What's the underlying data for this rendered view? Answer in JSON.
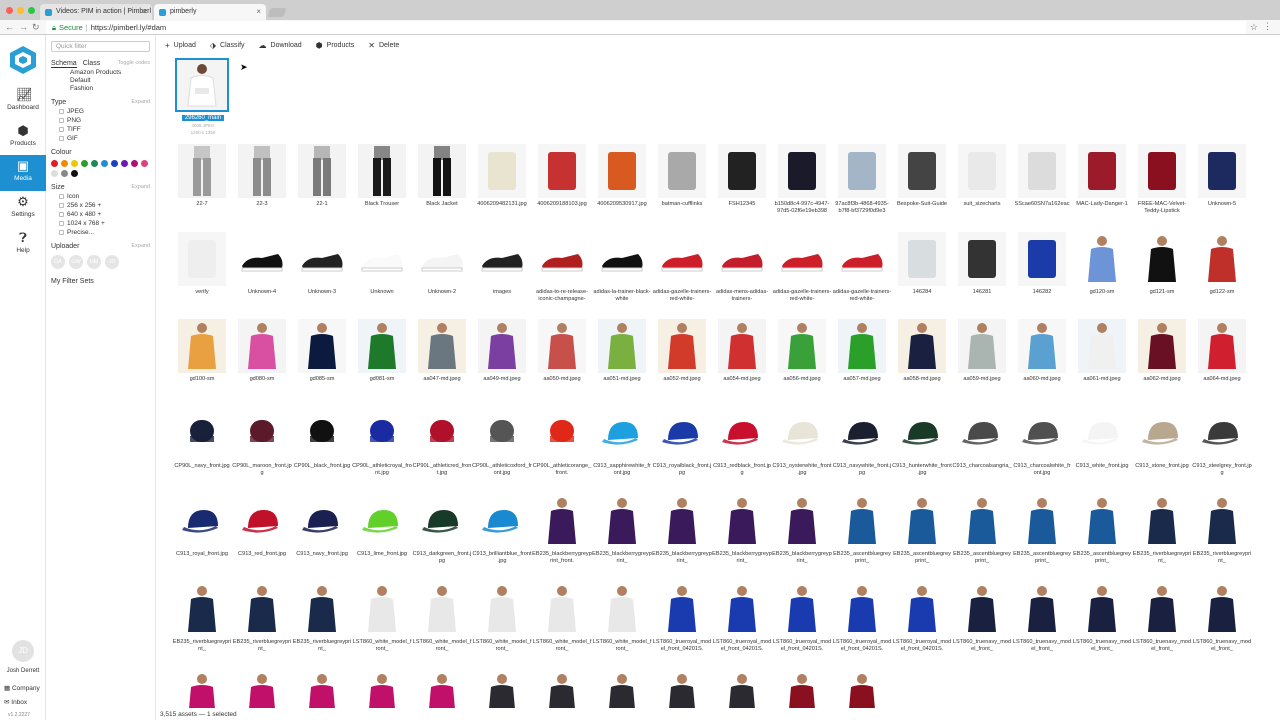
{
  "browser": {
    "tabs": [
      {
        "title": "Videos: PIM in action | Pimberl"
      },
      {
        "title": "pimberly"
      }
    ],
    "security_label": "Secure",
    "url": "https://pimberl.ly/#dam"
  },
  "rail": {
    "items": [
      {
        "label": "Dashboard",
        "icon": "chart-icon"
      },
      {
        "label": "Products",
        "icon": "cube-icon"
      },
      {
        "label": "Media",
        "icon": "image-icon",
        "active": true
      },
      {
        "label": "Settings",
        "icon": "gear-icon"
      },
      {
        "label": "Help",
        "icon": "help-icon"
      }
    ],
    "avatar_initials": "JD",
    "user_name": "Josh Derrett",
    "company_label": "Company",
    "inbox_label": "Inbox",
    "version": "v1.2.2227"
  },
  "filters": {
    "quick_filter_placeholder": "Quick filter",
    "schema_label": "Schema",
    "class_label": "Class",
    "toggle_label": "Toggle codes",
    "schema_items": [
      "Amazon Products",
      "Default",
      "Fashion"
    ],
    "type_label": "Type",
    "expand_label": "Expand",
    "types": [
      "JPEG",
      "PNG",
      "TIFF",
      "GIF"
    ],
    "colour_label": "Colour",
    "colours": [
      "#e02020",
      "#f08a00",
      "#f0c800",
      "#2aa02a",
      "#1a8a5a",
      "#1e8fd0",
      "#1a3fc0",
      "#6a1ab0",
      "#b0107a",
      "#e04080",
      "#dddddd",
      "#888888",
      "#111111"
    ],
    "size_label": "Size",
    "sizes": [
      "Icon",
      "256 x 256 +",
      "640 x 480 +",
      "1024 x 768 +",
      "Precise..."
    ],
    "uploader_label": "Uploader",
    "uploaders": [
      "DA",
      "GW",
      "HM",
      "JD"
    ],
    "my_filters_label": "My Filter Sets"
  },
  "toolbar": {
    "upload": "Upload",
    "classify": "Classify",
    "download": "Download",
    "products": "Products",
    "delete": "Delete"
  },
  "featured": {
    "label": "296260_main",
    "meta1": "4005 JPEG",
    "meta2": "1200 x 1350"
  },
  "rows": [
    [
      "22-7",
      "22-3",
      "22-1",
      "Black Trouser",
      "Black Jacket",
      "4006209482131.jpg",
      "4006209188103.jpg",
      "4006209530917.jpg",
      "batman-cufflinks",
      "FSH12345",
      "b150d8c4-997c-4947-97d5-02f6e19eb398",
      "97ac8f3b-4868-4935-b7f8-bf3729f0d9e3",
      "Bespoke-Suit-Guide",
      "suit_sizecharts",
      "SScae60SN7a162eac",
      "MAC-Lady-Danger-1",
      "FREE-MAC-Velvet-Teddy-Lipstick",
      "Unknown-5"
    ],
    [
      "verify",
      "Unknown-4",
      "Unknown-3",
      "Unknown",
      "Unknown-2",
      "images",
      "adidas-to-re-release-iconic-champagne-",
      "adidas-la-trainer-black-white",
      "adidas-gazelle-trainers-red-white-",
      "adidas-mens-adidas-trainers-",
      "adidas-gazelle-trainers-red-white-",
      "adidas-gazelle-trainers-red-white-",
      "146284",
      "146281",
      "146282",
      "gd120-sm",
      "gd121-sm",
      "gd122-sm"
    ],
    [
      "gd100-sm",
      "gd080-sm",
      "gd085-sm",
      "gd081-sm",
      "aa047-md.jpeg",
      "aa049-md.jpeg",
      "aa050-md.jpeg",
      "aa051-md.jpeg",
      "aa052-md.jpeg",
      "aa054-md.jpeg",
      "aa056-md.jpeg",
      "aa057-md.jpeg",
      "aa058-md.jpeg",
      "aa059-md.jpeg",
      "aa060-md.jpeg",
      "aa061-md.jpeg",
      "aa062-md.jpeg",
      "aa064-md.jpeg"
    ],
    [
      "CP90L_navy_front.jpg",
      "CP90L_maroon_front.jpg",
      "CP90L_black_front.jpg",
      "CP90L_athleticroyal_front.jpg",
      "CP90L_athleticred_front.jpg",
      "CP90L_athleticoxford_front.jpg",
      "CP90L_athleticorange_front.",
      "C913_sapphirewhite_front.jpg",
      "C913_royalblack_front.jpg",
      "C913_redblack_front.jpg",
      "C913_oysterwhite_front.jpg",
      "C913_navywhite_front.jpg",
      "C913_hunterwhite_front.jpg",
      "C913_charcoalsangria_",
      "C913_charcoalwhite_front.jpg",
      "C913_white_front.jpg",
      "C913_stone_front.jpg",
      "C913_steelgrey_front.jpg"
    ],
    [
      "C913_royal_front.jpg",
      "C913_red_front.jpg",
      "C913_navy_front.jpg",
      "C913_lime_front.jpg",
      "C913_darkgreen_front.jpg",
      "C913_brilliantblue_front.jpg",
      "EB235_blackberrygreyprint_front.",
      "EB235_blackberrygreyprint_",
      "EB235_blackberrygreyprint_",
      "EB235_blackberrygreyprint_",
      "EB235_blackberrygreyprint_",
      "EB235_ascentbluegreyprint_",
      "EB235_ascentbluegreyprint_",
      "EB235_ascentbluegreyprint_",
      "EB235_ascentbluegreyprint_",
      "EB235_ascentbluegreyprint_",
      "EB235_riverbluegreyprint_",
      "EB235_riverbluegreyprint_"
    ],
    [
      "EB235_riverbluegreyprint_",
      "EB235_riverbluegreyprint_",
      "EB235_riverbluegreyprint_",
      "LST860_white_model_front_",
      "LST860_white_model_front_",
      "LST860_white_model_front_",
      "LST860_white_model_front_",
      "LST860_white_model_front_",
      "LST860_trueroyal_model_front_04201S.",
      "LST860_trueroyal_model_front_04201S.",
      "LST860_trueroyal_model_front_04201S.",
      "LST860_trueroyal_model_front_04201S.",
      "LST860_trueroyal_model_front_04201S.",
      "LST860_truenavy_model_front_",
      "LST860_truenavy_model_front_",
      "LST860_truenavy_model_front_",
      "LST860_truenavy_model_front_",
      "LST860_truenavy_model_front_"
    ],
    [
      "",
      "",
      "",
      "",
      "",
      "",
      "",
      "",
      "",
      "",
      "",
      ""
    ]
  ],
  "status": "3,515 assets — 1 selected"
}
